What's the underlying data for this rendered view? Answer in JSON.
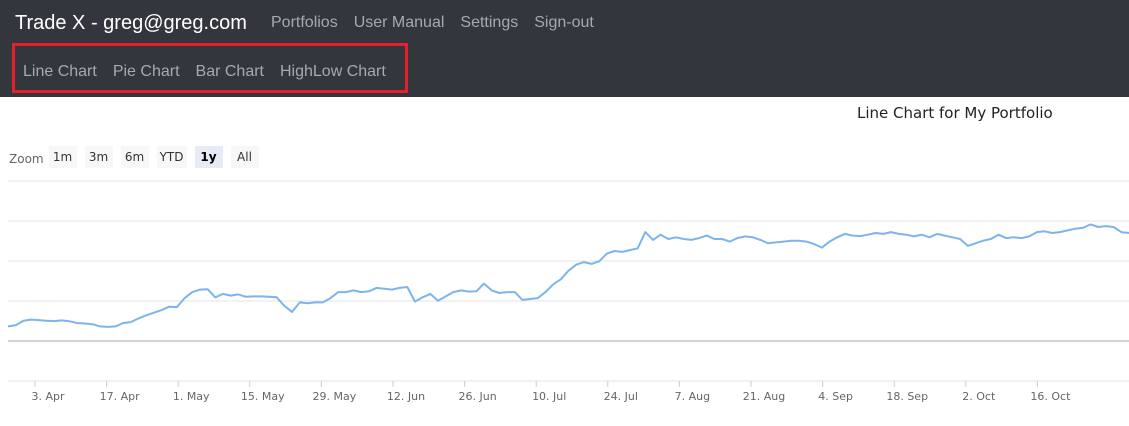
{
  "header": {
    "brand": "Trade X - greg@greg.com",
    "nav": [
      "Portfolios",
      "User Manual",
      "Settings",
      "Sign-out"
    ],
    "chart_nav": [
      "Line Chart",
      "Pie Chart",
      "Bar Chart",
      "HighLow Chart"
    ],
    "highlight_color": "#e4202a"
  },
  "zoom": {
    "label": "Zoom",
    "buttons": [
      "1m",
      "3m",
      "6m",
      "YTD",
      "1y",
      "All"
    ],
    "active": "1y"
  },
  "chart_data": {
    "type": "line",
    "title": "Line Chart for My Portfolio",
    "x_tick_labels": [
      "3. Apr",
      "17. Apr",
      "1. May",
      "15. May",
      "29. May",
      "12. Jun",
      "26. Jun",
      "10. Jul",
      "24. Jul",
      "7. Aug",
      "21. Aug",
      "4. Sep",
      "18. Sep",
      "2. Oct",
      "16. Oct"
    ],
    "y_tick_labels": [],
    "grid": true,
    "legend": "none",
    "series": [
      {
        "color": "#7cb5ec",
        "values": [
          0.85,
          0.92,
          1.18,
          1.25,
          1.22,
          1.18,
          1.16,
          1.2,
          1.15,
          1.05,
          1.02,
          0.98,
          0.85,
          0.82,
          0.85,
          1.05,
          1.1,
          1.32,
          1.5,
          1.65,
          1.8,
          2.0,
          1.98,
          2.5,
          2.85,
          3.0,
          3.02,
          2.55,
          2.75,
          2.65,
          2.72,
          2.58,
          2.6,
          2.6,
          2.58,
          2.55,
          2.05,
          1.7,
          2.25,
          2.2,
          2.25,
          2.25,
          2.5,
          2.85,
          2.85,
          2.95,
          2.85,
          2.9,
          3.1,
          3.05,
          3.0,
          3.1,
          3.15,
          2.3,
          2.55,
          2.75,
          2.35,
          2.6,
          2.85,
          2.95,
          2.88,
          2.9,
          3.35,
          2.95,
          2.8,
          2.85,
          2.85,
          2.4,
          2.45,
          2.5,
          2.85,
          3.3,
          3.6,
          4.1,
          4.45,
          4.6,
          4.5,
          4.65,
          5.1,
          5.25,
          5.2,
          5.3,
          5.4,
          6.35,
          5.9,
          6.2,
          5.95,
          6.05,
          5.95,
          5.9,
          6.0,
          6.15,
          5.95,
          5.95,
          5.8,
          6.0,
          6.1,
          6.05,
          5.9,
          5.7,
          5.75,
          5.8,
          5.85,
          5.85,
          5.8,
          5.65,
          5.45,
          5.8,
          6.05,
          6.25,
          6.15,
          6.12,
          6.2,
          6.3,
          6.25,
          6.35,
          6.25,
          6.2,
          6.1,
          6.2,
          6.05,
          6.25,
          6.15,
          6.05,
          5.95,
          5.55,
          5.7,
          5.85,
          5.95,
          6.2,
          6.0,
          6.05,
          6.0,
          6.1,
          6.35,
          6.4,
          6.3,
          6.35,
          6.45,
          6.55,
          6.6,
          6.8,
          6.65,
          6.7,
          6.65,
          6.35,
          6.3
        ]
      }
    ]
  }
}
